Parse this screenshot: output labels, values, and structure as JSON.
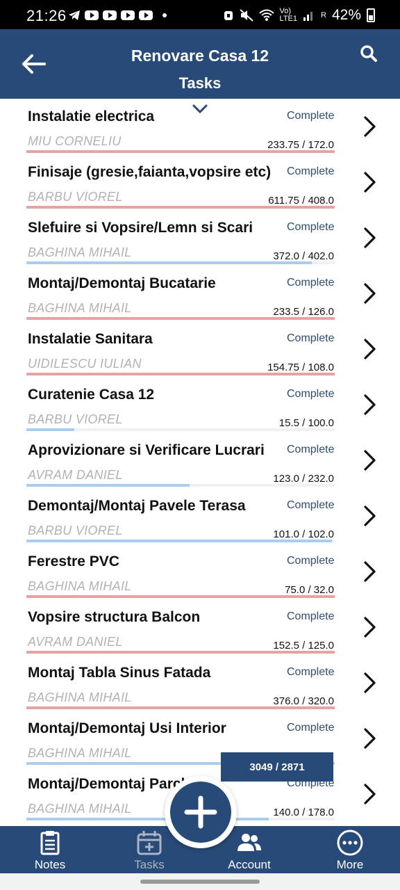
{
  "status_bar": {
    "time": "21:26",
    "battery": "42%",
    "net_top": "Vo)",
    "net_bottom": "LTE1",
    "signal_r": "R"
  },
  "header": {
    "title": "Renovare Casa 12",
    "subtitle": "Tasks"
  },
  "colors": {
    "brand": "#284a78",
    "over_budget": "#e8a3a3",
    "under_budget": "#a9cdf0",
    "status_text": "#2f4c6e"
  },
  "tasks": [
    {
      "name": "Instalatie electrica",
      "status": "Complete",
      "assignee": "MIU CORNELIU",
      "hours": "233.75 / 172.0",
      "progress_pct": 100,
      "state": "over"
    },
    {
      "name": "Finisaje (gresie,faianta,vopsire etc)",
      "status": "Complete",
      "assignee": "BARBU VIOREL",
      "hours": "611.75 / 408.0",
      "progress_pct": 100,
      "state": "over"
    },
    {
      "name": "Slefuire si Vopsire/Lemn si Scari",
      "status": "Complete",
      "assignee": "BAGHINA MIHAIL",
      "hours": "372.0 / 402.0",
      "progress_pct": 92.5,
      "state": "under"
    },
    {
      "name": "Montaj/Demontaj Bucatarie",
      "status": "Complete",
      "assignee": "BAGHINA MIHAIL",
      "hours": "233.5 / 126.0",
      "progress_pct": 100,
      "state": "over"
    },
    {
      "name": "Instalatie Sanitara",
      "status": "Complete",
      "assignee": "UIDILESCU IULIAN",
      "hours": "154.75 / 108.0",
      "progress_pct": 100,
      "state": "over"
    },
    {
      "name": "Curatenie Casa 12",
      "status": "Complete",
      "assignee": "BARBU VIOREL",
      "hours": "15.5 / 100.0",
      "progress_pct": 15.5,
      "state": "under"
    },
    {
      "name": "Aprovizionare si Verificare Lucrari",
      "status": "Complete",
      "assignee": "AVRAM DANIEL",
      "hours": "123.0 / 232.0",
      "progress_pct": 53,
      "state": "under"
    },
    {
      "name": "Demontaj/Montaj Pavele Terasa",
      "status": "Complete",
      "assignee": "BARBU VIOREL",
      "hours": "101.0 / 102.0",
      "progress_pct": 99,
      "state": "under"
    },
    {
      "name": "Ferestre PVC",
      "status": "Complete",
      "assignee": "BAGHINA MIHAIL",
      "hours": "75.0 / 32.0",
      "progress_pct": 100,
      "state": "over"
    },
    {
      "name": "Vopsire structura Balcon",
      "status": "Complete",
      "assignee": "AVRAM DANIEL",
      "hours": "152.5 / 125.0",
      "progress_pct": 100,
      "state": "over"
    },
    {
      "name": "Montaj Tabla Sinus Fatada",
      "status": "Complete",
      "assignee": "BAGHINA MIHAIL",
      "hours": "376.0 / 320.0",
      "progress_pct": 100,
      "state": "over"
    },
    {
      "name": "Montaj/Demontaj Usi Interior",
      "status": "Complete",
      "assignee": "BAGHINA MIHAIL",
      "hours": "",
      "progress_pct": 100,
      "state": "under"
    },
    {
      "name": "Montaj/Demontaj Parchet",
      "status": "Complete",
      "assignee": "BAGHINA MIHAIL",
      "hours": "140.0 / 178.0",
      "progress_pct": 78.7,
      "state": "under"
    }
  ],
  "total": "3049 / 2871",
  "nav": [
    {
      "label": "Notes",
      "icon": "clipboard-icon",
      "active": true
    },
    {
      "label": "Tasks",
      "icon": "calendar-add-icon",
      "active": false
    },
    {
      "label": "Account",
      "icon": "people-icon",
      "active": true
    },
    {
      "label": "More",
      "icon": "more-icon",
      "active": true
    }
  ]
}
